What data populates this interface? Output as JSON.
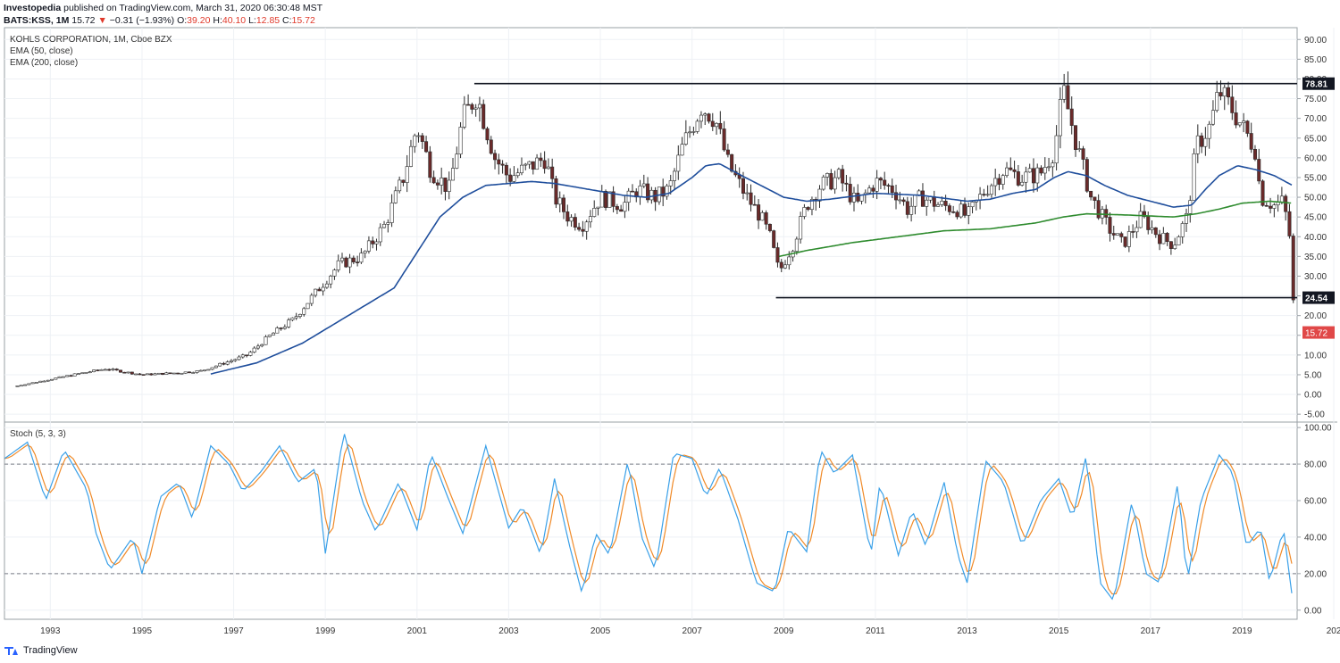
{
  "header": {
    "publisher": "Investopedia",
    "published_text": "published on TradingView.com, March 31, 2020 06:30:48 MST",
    "symbol": "BATS:KSS, 1M",
    "last": "15.72",
    "arrow": "▼",
    "change": "−0.31 (−1.93%)",
    "o_label": "O:",
    "o_value": "39.20",
    "h_label": "H:",
    "h_value": "40.10",
    "l_label": "L:",
    "l_value": "12.85",
    "c_label": "C:",
    "c_value": "15.72"
  },
  "legend": {
    "title": "KOHLS CORPORATION, 1M, Cboe BZX",
    "ema50": "EMA (50, close)",
    "ema200": "EMA (200, close)"
  },
  "stoch_label": "Stoch (5, 3, 3)",
  "footer": {
    "brand": "TradingView"
  },
  "colors": {
    "candle_up": "#ffffff",
    "candle_down": "#6b2a2a",
    "ema50": "#1f4e9c",
    "ema200": "#2e8b2e",
    "stoch_k": "#3aa0e8",
    "stoch_d": "#f08a28",
    "last_price_badge": "#e04848",
    "level_badge": "#131722"
  },
  "chart_data": {
    "type": "candlestick",
    "price_axis": {
      "ticks": [
        "90.00",
        "85.00",
        "80.00",
        "75.00",
        "70.00",
        "65.00",
        "60.00",
        "55.00",
        "50.00",
        "45.00",
        "40.00",
        "35.00",
        "30.00",
        "25.00",
        "20.00",
        "15.00",
        "10.00",
        "5.00",
        "0.00",
        "-5.00"
      ],
      "ylim": [
        -7,
        93
      ]
    },
    "time_axis": {
      "ticks": [
        "1993",
        "1995",
        "1997",
        "1999",
        "2001",
        "2003",
        "2005",
        "2007",
        "2009",
        "2011",
        "2013",
        "2015",
        "2017",
        "2019",
        "202"
      ],
      "xlim": [
        1992.0,
        2020.2
      ]
    },
    "levels": [
      {
        "value": 78.81,
        "label": "78.81",
        "from": 2002.25,
        "to": 2020.2
      },
      {
        "value": 24.54,
        "label": "24.54",
        "from": 2008.83,
        "to": 2020.2
      }
    ],
    "last_price": {
      "value": 15.72,
      "label": "15.72"
    },
    "price_anchors": [
      [
        1992.2,
        2
      ],
      [
        1993.5,
        5
      ],
      [
        1994.2,
        6.5
      ],
      [
        1995.0,
        5
      ],
      [
        1995.8,
        5.5
      ],
      [
        1996.3,
        6
      ],
      [
        1996.8,
        8
      ],
      [
        1997.3,
        10
      ],
      [
        1997.8,
        15
      ],
      [
        1998.3,
        19
      ],
      [
        1998.8,
        26
      ],
      [
        1999.3,
        33
      ],
      [
        1999.8,
        35
      ],
      [
        2000.3,
        43
      ],
      [
        2000.7,
        55
      ],
      [
        2001.0,
        68
      ],
      [
        2001.3,
        57
      ],
      [
        2001.7,
        52
      ],
      [
        2002.0,
        70
      ],
      [
        2002.3,
        76
      ],
      [
        2002.7,
        60
      ],
      [
        2003.0,
        55
      ],
      [
        2003.5,
        58
      ],
      [
        2003.8,
        60
      ],
      [
        2004.0,
        50
      ],
      [
        2004.3,
        45
      ],
      [
        2004.6,
        43
      ],
      [
        2005.0,
        50
      ],
      [
        2005.5,
        48
      ],
      [
        2005.8,
        52
      ],
      [
        2006.2,
        50
      ],
      [
        2006.5,
        52
      ],
      [
        2006.8,
        63
      ],
      [
        2007.2,
        73
      ],
      [
        2007.5,
        70
      ],
      [
        2007.8,
        58
      ],
      [
        2008.2,
        50
      ],
      [
        2008.5,
        45
      ],
      [
        2008.7,
        40
      ],
      [
        2008.9,
        31
      ],
      [
        2009.2,
        38
      ],
      [
        2009.5,
        48
      ],
      [
        2009.8,
        53
      ],
      [
        2010.2,
        55
      ],
      [
        2010.6,
        48
      ],
      [
        2011.0,
        54
      ],
      [
        2011.4,
        52
      ],
      [
        2011.7,
        47
      ],
      [
        2012.0,
        50
      ],
      [
        2012.4,
        48
      ],
      [
        2012.8,
        47
      ],
      [
        2013.0,
        45
      ],
      [
        2013.4,
        52
      ],
      [
        2013.8,
        57
      ],
      [
        2014.2,
        55
      ],
      [
        2014.6,
        56
      ],
      [
        2014.9,
        62
      ],
      [
        2015.1,
        77
      ],
      [
        2015.4,
        63
      ],
      [
        2015.7,
        50
      ],
      [
        2016.1,
        42
      ],
      [
        2016.4,
        38
      ],
      [
        2016.8,
        45
      ],
      [
        2017.2,
        40
      ],
      [
        2017.5,
        38
      ],
      [
        2017.8,
        45
      ],
      [
        2018.0,
        63
      ],
      [
        2018.3,
        68
      ],
      [
        2018.5,
        77
      ],
      [
        2018.8,
        72
      ],
      [
        2019.0,
        68
      ],
      [
        2019.3,
        62
      ],
      [
        2019.4,
        50
      ],
      [
        2019.7,
        48
      ],
      [
        2019.9,
        49
      ],
      [
        2020.05,
        39.2
      ],
      [
        2020.15,
        15.72
      ]
    ],
    "ema50_anchors": [
      [
        1996.5,
        5.2
      ],
      [
        1997.5,
        8
      ],
      [
        1998.5,
        13
      ],
      [
        1999.5,
        20
      ],
      [
        2000.5,
        27
      ],
      [
        2001.0,
        36
      ],
      [
        2001.5,
        45
      ],
      [
        2002.0,
        50
      ],
      [
        2002.5,
        53
      ],
      [
        2003.0,
        53.5
      ],
      [
        2003.5,
        54
      ],
      [
        2004.0,
        53.5
      ],
      [
        2004.5,
        52.5
      ],
      [
        2005.0,
        51.5
      ],
      [
        2005.5,
        50.5
      ],
      [
        2006.0,
        50
      ],
      [
        2006.5,
        51
      ],
      [
        2007.0,
        55
      ],
      [
        2007.3,
        58
      ],
      [
        2007.6,
        58.5
      ],
      [
        2008.0,
        56
      ],
      [
        2008.5,
        53
      ],
      [
        2009.0,
        50
      ],
      [
        2009.5,
        49
      ],
      [
        2010.0,
        49.5
      ],
      [
        2011.0,
        51
      ],
      [
        2012.0,
        50.5
      ],
      [
        2013.0,
        49
      ],
      [
        2013.5,
        49.5
      ],
      [
        2014.0,
        51
      ],
      [
        2014.5,
        52
      ],
      [
        2014.9,
        55
      ],
      [
        2015.2,
        56.5
      ],
      [
        2015.6,
        55.5
      ],
      [
        2016.0,
        53
      ],
      [
        2016.5,
        50.5
      ],
      [
        2017.0,
        49
      ],
      [
        2017.5,
        47.5
      ],
      [
        2017.9,
        48
      ],
      [
        2018.2,
        52
      ],
      [
        2018.5,
        55.5
      ],
      [
        2018.9,
        58
      ],
      [
        2019.3,
        57
      ],
      [
        2019.7,
        55.5
      ],
      [
        2020.1,
        53
      ]
    ],
    "ema200_anchors": [
      [
        2008.9,
        35
      ],
      [
        2009.5,
        36.5
      ],
      [
        2010.5,
        38.5
      ],
      [
        2011.5,
        40
      ],
      [
        2012.5,
        41.5
      ],
      [
        2013.5,
        42
      ],
      [
        2014.5,
        43.5
      ],
      [
        2015.1,
        45
      ],
      [
        2015.6,
        45.8
      ],
      [
        2016.5,
        45.5
      ],
      [
        2017.5,
        45
      ],
      [
        2018.0,
        45.8
      ],
      [
        2018.5,
        47
      ],
      [
        2019.0,
        48.5
      ],
      [
        2019.6,
        49
      ],
      [
        2020.1,
        48.5
      ]
    ],
    "stoch": {
      "name": "Stoch (5, 3, 3)",
      "ylim": [
        -5,
        103
      ],
      "ticks": [
        "100.00",
        "80.00",
        "60.00",
        "40.00",
        "20.00",
        "0.00"
      ],
      "bands": [
        80,
        20
      ],
      "k_anchors": [
        [
          1992.0,
          83
        ],
        [
          1992.5,
          92
        ],
        [
          1992.9,
          60
        ],
        [
          1993.3,
          88
        ],
        [
          1993.8,
          66
        ],
        [
          1994.0,
          42
        ],
        [
          1994.3,
          22
        ],
        [
          1994.8,
          40
        ],
        [
          1995.0,
          20
        ],
        [
          1995.4,
          62
        ],
        [
          1995.8,
          70
        ],
        [
          1996.1,
          50
        ],
        [
          1996.5,
          90
        ],
        [
          1996.9,
          80
        ],
        [
          1997.2,
          65
        ],
        [
          1997.6,
          76
        ],
        [
          1998.0,
          90
        ],
        [
          1998.4,
          70
        ],
        [
          1998.8,
          78
        ],
        [
          1999.0,
          31
        ],
        [
          1999.4,
          98
        ],
        [
          1999.8,
          60
        ],
        [
          2000.1,
          43
        ],
        [
          2000.6,
          70
        ],
        [
          2001.0,
          44
        ],
        [
          2001.3,
          86
        ],
        [
          2001.7,
          60
        ],
        [
          2002.0,
          42
        ],
        [
          2002.5,
          90
        ],
        [
          2003.0,
          45
        ],
        [
          2003.3,
          57
        ],
        [
          2003.7,
          30
        ],
        [
          2004.0,
          72
        ],
        [
          2004.3,
          38
        ],
        [
          2004.6,
          9
        ],
        [
          2004.9,
          42
        ],
        [
          2005.2,
          30
        ],
        [
          2005.6,
          82
        ],
        [
          2005.9,
          40
        ],
        [
          2006.2,
          22
        ],
        [
          2006.6,
          86
        ],
        [
          2007.0,
          83
        ],
        [
          2007.3,
          62
        ],
        [
          2007.6,
          78
        ],
        [
          2008.0,
          50
        ],
        [
          2008.4,
          15
        ],
        [
          2008.8,
          10
        ],
        [
          2009.1,
          45
        ],
        [
          2009.5,
          32
        ],
        [
          2009.8,
          88
        ],
        [
          2010.1,
          75
        ],
        [
          2010.5,
          85
        ],
        [
          2010.9,
          30
        ],
        [
          2011.1,
          70
        ],
        [
          2011.5,
          30
        ],
        [
          2011.8,
          55
        ],
        [
          2012.1,
          35
        ],
        [
          2012.5,
          70
        ],
        [
          2012.8,
          30
        ],
        [
          2013.0,
          15
        ],
        [
          2013.4,
          82
        ],
        [
          2013.8,
          70
        ],
        [
          2014.2,
          35
        ],
        [
          2014.6,
          60
        ],
        [
          2015.0,
          72
        ],
        [
          2015.3,
          50
        ],
        [
          2015.6,
          85
        ],
        [
          2015.9,
          15
        ],
        [
          2016.2,
          5
        ],
        [
          2016.6,
          60
        ],
        [
          2016.9,
          20
        ],
        [
          2017.2,
          15
        ],
        [
          2017.6,
          70
        ],
        [
          2017.8,
          15
        ],
        [
          2018.1,
          60
        ],
        [
          2018.5,
          85
        ],
        [
          2018.8,
          75
        ],
        [
          2019.1,
          35
        ],
        [
          2019.4,
          45
        ],
        [
          2019.6,
          15
        ],
        [
          2019.9,
          45
        ],
        [
          2020.1,
          6
        ]
      ]
    }
  }
}
